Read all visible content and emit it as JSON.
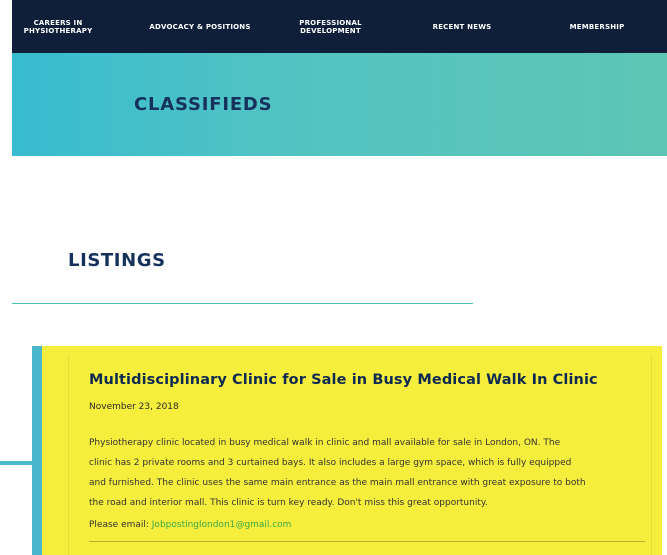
{
  "nav": {
    "items": [
      {
        "label": "CAREERS IN\nPHYSIOTHERAPY"
      },
      {
        "label": "ADVOCACY & POSITIONS"
      },
      {
        "label": "PROFESSIONAL\nDEVELOPMENT"
      },
      {
        "label": "RECENT NEWS"
      },
      {
        "label": "MEMBERSHIP"
      }
    ]
  },
  "hero": {
    "title": "CLASSIFIEDS"
  },
  "listings": {
    "heading": "LISTINGS",
    "items": [
      {
        "title": "Multidisciplinary Clinic for Sale in Busy Medical Walk In Clinic",
        "date": "November 23, 2018",
        "body_lines": [
          "Physiotherapy clinic located in busy medical walk in clinic and mall available for sale in London, ON. The",
          "clinic has 2 private rooms and 3 curtained bays. It also includes a large gym space, which is fully equipped",
          "and furnished. The clinic uses the same main entrance as the main mall entrance with great exposure to both",
          "the road and interior mall. This clinic is turn key ready. Don't miss this great opportunity."
        ],
        "email_prefix": "Please email: ",
        "email": "Jobpostinglondon1@gmail.com"
      }
    ]
  },
  "colors": {
    "nav_bg": "#0f1f3a",
    "hero_gradient_start": "#37bccf",
    "hero_gradient_end": "#5ec6b4",
    "heading_text": "#15315c",
    "card_bg": "#f6ee3c",
    "accent": "#4bb7cc",
    "link": "#3aa84a"
  }
}
